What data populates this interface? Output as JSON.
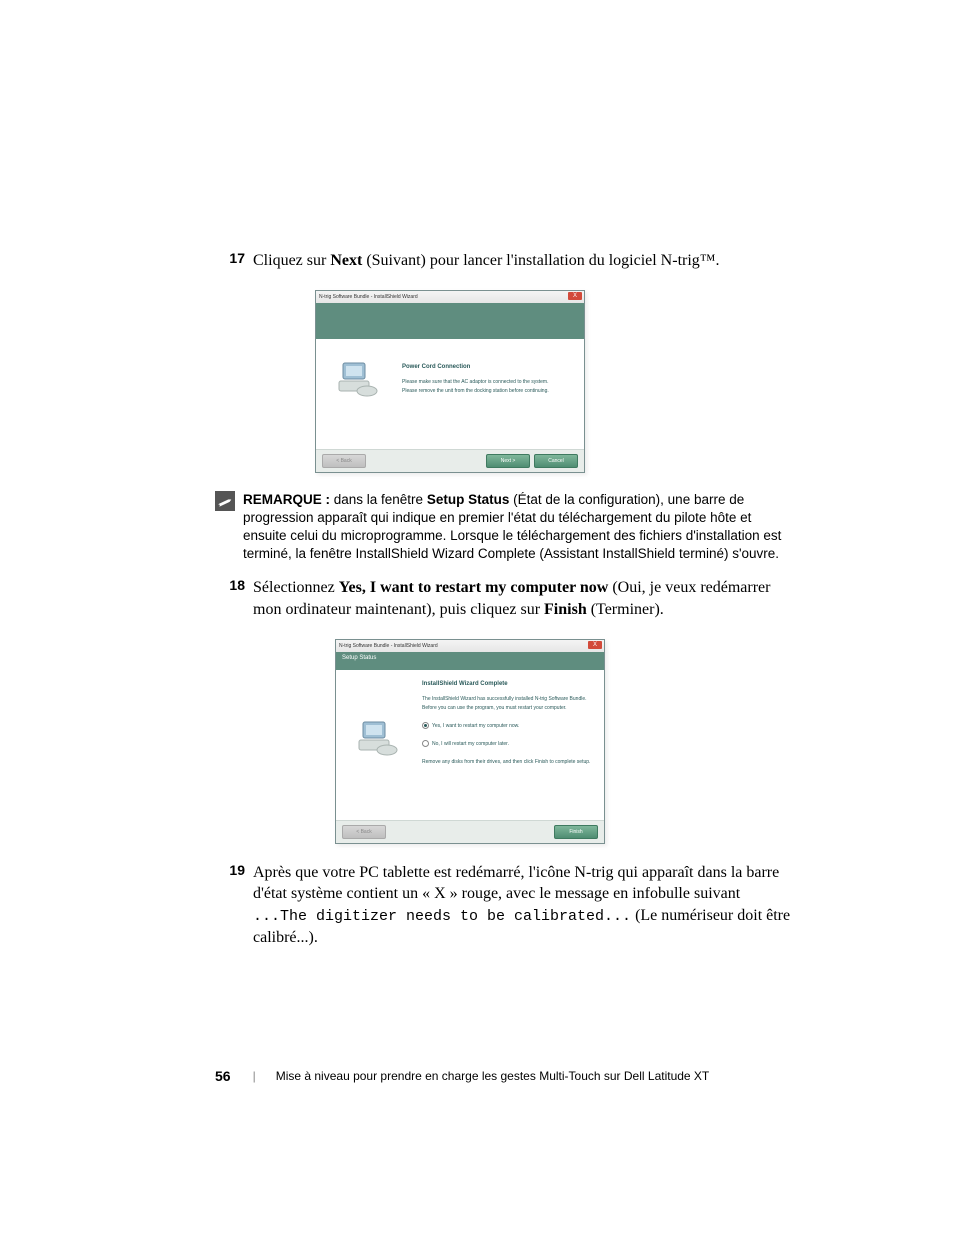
{
  "steps": {
    "s17": {
      "num": "17",
      "prefix": "Cliquez sur ",
      "next": "Next",
      "suffix": " (Suivant) pour lancer l'installation du logiciel N-trig™."
    },
    "s18": {
      "num": "18",
      "a": "Sélectionnez ",
      "yes_bold": "Yes, I want to restart my computer now",
      "b": " (Oui, je veux redémarrer mon ordinateur maintenant), puis cliquez sur ",
      "finish": "Finish",
      "c": " (Terminer)."
    },
    "s19": {
      "num": "19",
      "a": "Après que votre PC tablette est redémarré, l'icône N-trig qui apparaît dans la barre d'état système contient un « X » rouge, avec le message en infobulle suivant ",
      "code1": "...The digitizer needs to be calibrated...",
      "b": " (Le numériseur doit être calibré...)."
    }
  },
  "remark": {
    "label": "REMARQUE :",
    "text_a": " dans la fenêtre ",
    "setup_status": "Setup Status",
    "text_b": " (État de la configuration), une barre de progression apparaît qui indique en premier l'état du téléchargement du pilote hôte et ensuite celui du microprogramme. Lorsque le téléchargement des fichiers d'installation est terminé, la fenêtre InstallShield Wizard Complete (Assistant InstallShield terminé) s'ouvre."
  },
  "dlg1": {
    "title": "N-trig Software Bundle - InstallShield Wizard",
    "close": "X",
    "heading": "Power Cord Connection",
    "line1": "Please make sure that the AC adaptor is connected to the system.",
    "line2": "Please remove the unit from the docking station before continuing.",
    "btn_back": "< Back",
    "btn_next": "Next >",
    "btn_cancel": "Cancel"
  },
  "dlg2": {
    "title": "N-trig Software Bundle - InstallShield Wizard",
    "close": "X",
    "banner_label": "Setup Status",
    "heading": "InstallShield Wizard Complete",
    "lead": "The InstallShield Wizard has successfully installed N-trig Software Bundle. Before you can use the program, you must restart your computer.",
    "radio_yes": "Yes, I want to restart my computer now.",
    "radio_no": "No, I will restart my computer later.",
    "removal": "Remove any disks from their drives, and then click Finish to complete setup.",
    "btn_back": "< Back",
    "btn_finish": "Finish"
  },
  "footer": {
    "page": "56",
    "title": "Mise à niveau pour prendre en charge les gestes Multi-Touch sur Dell Latitude XT"
  }
}
